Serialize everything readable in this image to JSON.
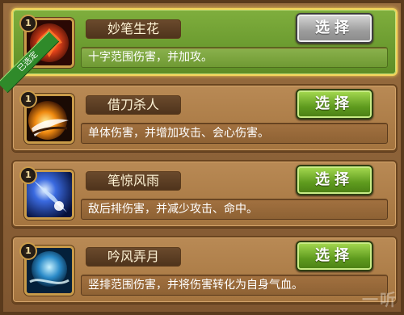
{
  "skills": [
    {
      "name": "妙笔生花",
      "description": "十字范围伤害，并加攻。",
      "level": "1",
      "button_label": "选择",
      "selected": true,
      "selected_badge": "已选定",
      "icon": "fire-flower-icon"
    },
    {
      "name": "借刀杀人",
      "description": "单体伤害，并增加攻击、会心伤害。",
      "level": "1",
      "button_label": "选择",
      "selected": false,
      "icon": "blade-slash-icon"
    },
    {
      "name": "笔惊风雨",
      "description": "敌后排伤害，并减少攻击、命中。",
      "level": "1",
      "button_label": "选择",
      "selected": false,
      "icon": "storm-comet-icon"
    },
    {
      "name": "吟风弄月",
      "description": "竖排范围伤害，并将伤害转化为自身气血。",
      "level": "1",
      "button_label": "选择",
      "selected": false,
      "icon": "moon-wind-icon"
    }
  ],
  "watermark": "一听"
}
